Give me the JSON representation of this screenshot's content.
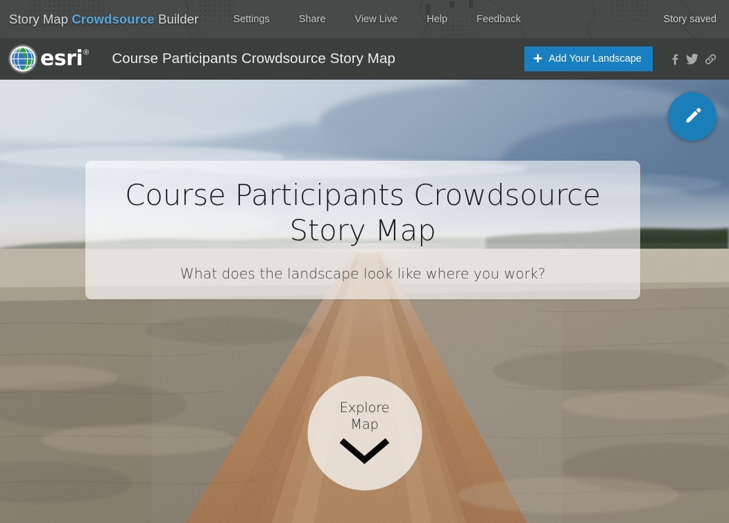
{
  "builder_nav": {
    "brand_prefix": "Story Map ",
    "brand_highlight": "Crowdsource",
    "brand_suffix": " Builder",
    "links": [
      {
        "label": "Settings",
        "name": "settings"
      },
      {
        "label": "Share",
        "name": "share"
      },
      {
        "label": "View Live",
        "name": "view-live"
      },
      {
        "label": "Help",
        "name": "help"
      },
      {
        "label": "Feedback",
        "name": "feedback"
      }
    ],
    "status": "Story saved",
    "background_color": "#4a4c4c"
  },
  "story_header": {
    "logo_word": "esri",
    "logo_tm": "®",
    "title": "Course Participants Crowdsource Story Map",
    "add_button": {
      "label": "Add Your Landscape",
      "icon": "plus-icon",
      "color": "#1a7fc1"
    },
    "social": [
      {
        "name": "facebook-icon",
        "label": "f"
      },
      {
        "name": "twitter-icon",
        "label": "Twitter"
      },
      {
        "name": "link-icon",
        "label": "Link"
      }
    ],
    "background_color": "#3c3d3d"
  },
  "cover": {
    "edit_button": {
      "name": "edit-pencil-icon",
      "color": "#1a7fb8"
    },
    "title": "Course Participants Crowdsource Story Map",
    "subtitle": "What does the landscape look like where you work?",
    "explore_line1": "Explore",
    "explore_line2": "Map",
    "explore_icon": "chevron-down-icon",
    "image_description": "dirt road through dry harvested fields under cloudy sky"
  }
}
